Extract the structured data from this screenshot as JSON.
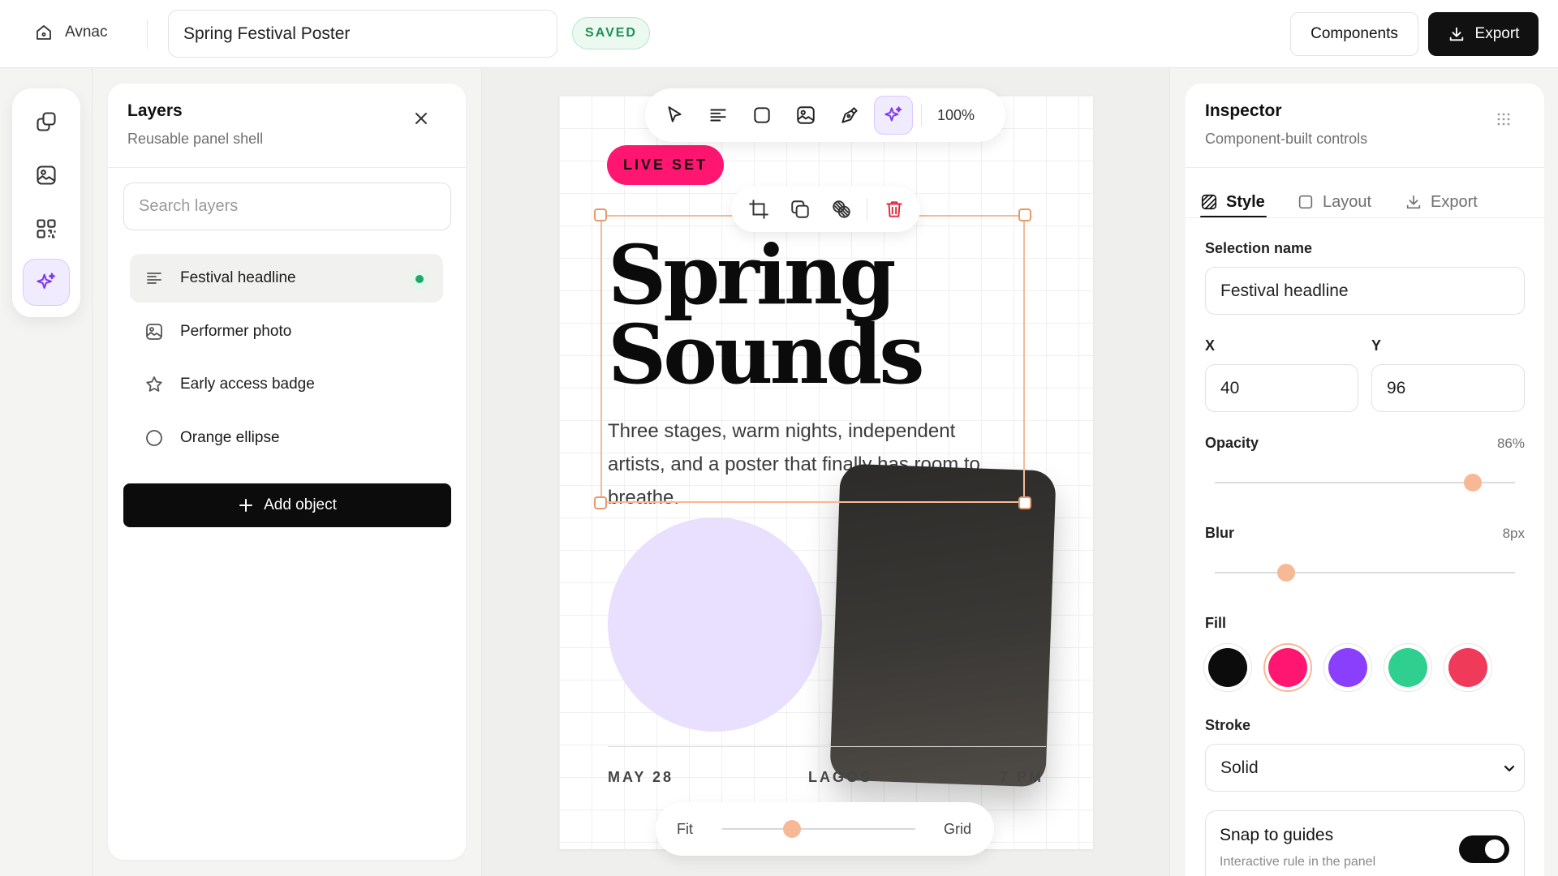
{
  "app": {
    "name": "Avnac"
  },
  "document": {
    "title": "Spring Festival Poster",
    "status": "SAVED"
  },
  "header": {
    "components_label": "Components",
    "export_label": "Export"
  },
  "rail": {
    "items": [
      {
        "icon": "layers-icon",
        "active": false
      },
      {
        "icon": "image-icon",
        "active": false
      },
      {
        "icon": "qr-code-icon",
        "active": false
      },
      {
        "icon": "sparkles-icon",
        "active": true
      }
    ]
  },
  "layers_panel": {
    "title": "Layers",
    "subtitle": "Reusable panel shell",
    "search_placeholder": "Search layers",
    "items": [
      {
        "label": "Festival headline",
        "icon": "text-lines-icon",
        "active": true,
        "status": "visible"
      },
      {
        "label": "Performer photo",
        "icon": "image-icon",
        "active": false
      },
      {
        "label": "Early access badge",
        "icon": "star-icon",
        "active": false
      },
      {
        "label": "Orange ellipse",
        "icon": "circle-icon",
        "active": false
      }
    ],
    "add_label": "Add object"
  },
  "toolbar": {
    "tools": [
      "select-pointer-icon",
      "text-icon",
      "rectangle-icon",
      "image-icon",
      "pen-icon",
      "sparkles-icon"
    ],
    "active_tool": "sparkles-icon",
    "zoom": "100%"
  },
  "selection_toolbar": {
    "tools": [
      "crop-icon",
      "duplicate-icon",
      "blend-icon",
      "trash-icon"
    ]
  },
  "poster": {
    "badge": "LIVE SET",
    "headline_line1": "Spring",
    "headline_line2": "Sounds",
    "body": "Three stages, warm nights, independent artists, and a poster that finally has room to breathe.",
    "date": "MAY 28",
    "city": "LAGOS",
    "time": "7 PM",
    "colors": {
      "badge": "#ff1670",
      "circle": "#e9dffe",
      "card": "#3b3936",
      "selection": "#f7b995"
    }
  },
  "zoom_bar": {
    "left_label": "Fit",
    "right_label": "Grid",
    "value": 0.36
  },
  "inspector": {
    "title": "Inspector",
    "subtitle": "Component-built controls",
    "tabs": [
      {
        "label": "Style",
        "icon": "hatch-icon",
        "active": true
      },
      {
        "label": "Layout",
        "icon": "square-icon",
        "active": false
      },
      {
        "label": "Export",
        "icon": "download-icon",
        "active": false
      }
    ],
    "selection_name_label": "Selection name",
    "selection_name": "Festival headline",
    "x_label": "X",
    "x_value": "40",
    "y_label": "Y",
    "y_value": "96",
    "opacity_label": "Opacity",
    "opacity_value": "86%",
    "opacity": 0.86,
    "blur_label": "Blur",
    "blur_value": "8px",
    "fill_label": "Fill",
    "fill_swatches": [
      "#0c0c0c",
      "#ff1670",
      "#8a3ffc",
      "#2fcf8f",
      "#f03a5a"
    ],
    "fill_selected": 1,
    "stroke_label": "Stroke",
    "stroke_options": [
      "Solid"
    ],
    "stroke_value": "Solid",
    "snap_title": "Snap to guides",
    "snap_subtitle": "Interactive rule in the panel",
    "snap_enabled": true
  }
}
